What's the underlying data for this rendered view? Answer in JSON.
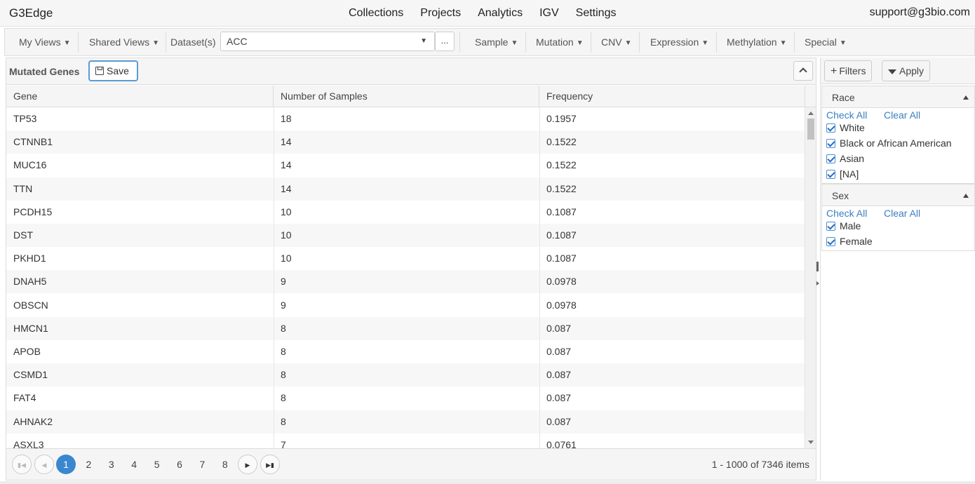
{
  "app": {
    "brand": "G3Edge",
    "support": "support@g3bio.com"
  },
  "nav": [
    "Collections",
    "Projects",
    "Analytics",
    "IGV",
    "Settings"
  ],
  "toolbar": {
    "my_views": "My Views",
    "shared_views": "Shared Views",
    "dataset_label": "Dataset(s)",
    "dataset_value": "ACC",
    "more": "...",
    "menus": [
      "Sample",
      "Mutation",
      "CNV",
      "Expression",
      "Methylation",
      "Special"
    ]
  },
  "panel": {
    "title": "Mutated Genes",
    "save": "Save",
    "columns": [
      "Gene",
      "Number of Samples",
      "Frequency"
    ],
    "rows": [
      [
        "TP53",
        "18",
        "0.1957"
      ],
      [
        "CTNNB1",
        "14",
        "0.1522"
      ],
      [
        "MUC16",
        "14",
        "0.1522"
      ],
      [
        "TTN",
        "14",
        "0.1522"
      ],
      [
        "PCDH15",
        "10",
        "0.1087"
      ],
      [
        "DST",
        "10",
        "0.1087"
      ],
      [
        "PKHD1",
        "10",
        "0.1087"
      ],
      [
        "DNAH5",
        "9",
        "0.0978"
      ],
      [
        "OBSCN",
        "9",
        "0.0978"
      ],
      [
        "HMCN1",
        "8",
        "0.087"
      ],
      [
        "APOB",
        "8",
        "0.087"
      ],
      [
        "CSMD1",
        "8",
        "0.087"
      ],
      [
        "FAT4",
        "8",
        "0.087"
      ],
      [
        "AHNAK2",
        "8",
        "0.087"
      ],
      [
        "ASXL3",
        "7",
        "0.0761"
      ]
    ],
    "pages": [
      "1",
      "2",
      "3",
      "4",
      "5",
      "6",
      "7",
      "8"
    ],
    "active_page": "1",
    "pager_info": "1 - 1000 of 7346 items"
  },
  "filters": {
    "add_label": "Filters",
    "apply_label": "Apply",
    "check_all": "Check All",
    "clear_all": "Clear All",
    "race": {
      "title": "Race",
      "options": [
        "White",
        "Black or African American",
        "Asian",
        "[NA]"
      ]
    },
    "sex": {
      "title": "Sex",
      "options": [
        "Male",
        "Female"
      ]
    }
  }
}
